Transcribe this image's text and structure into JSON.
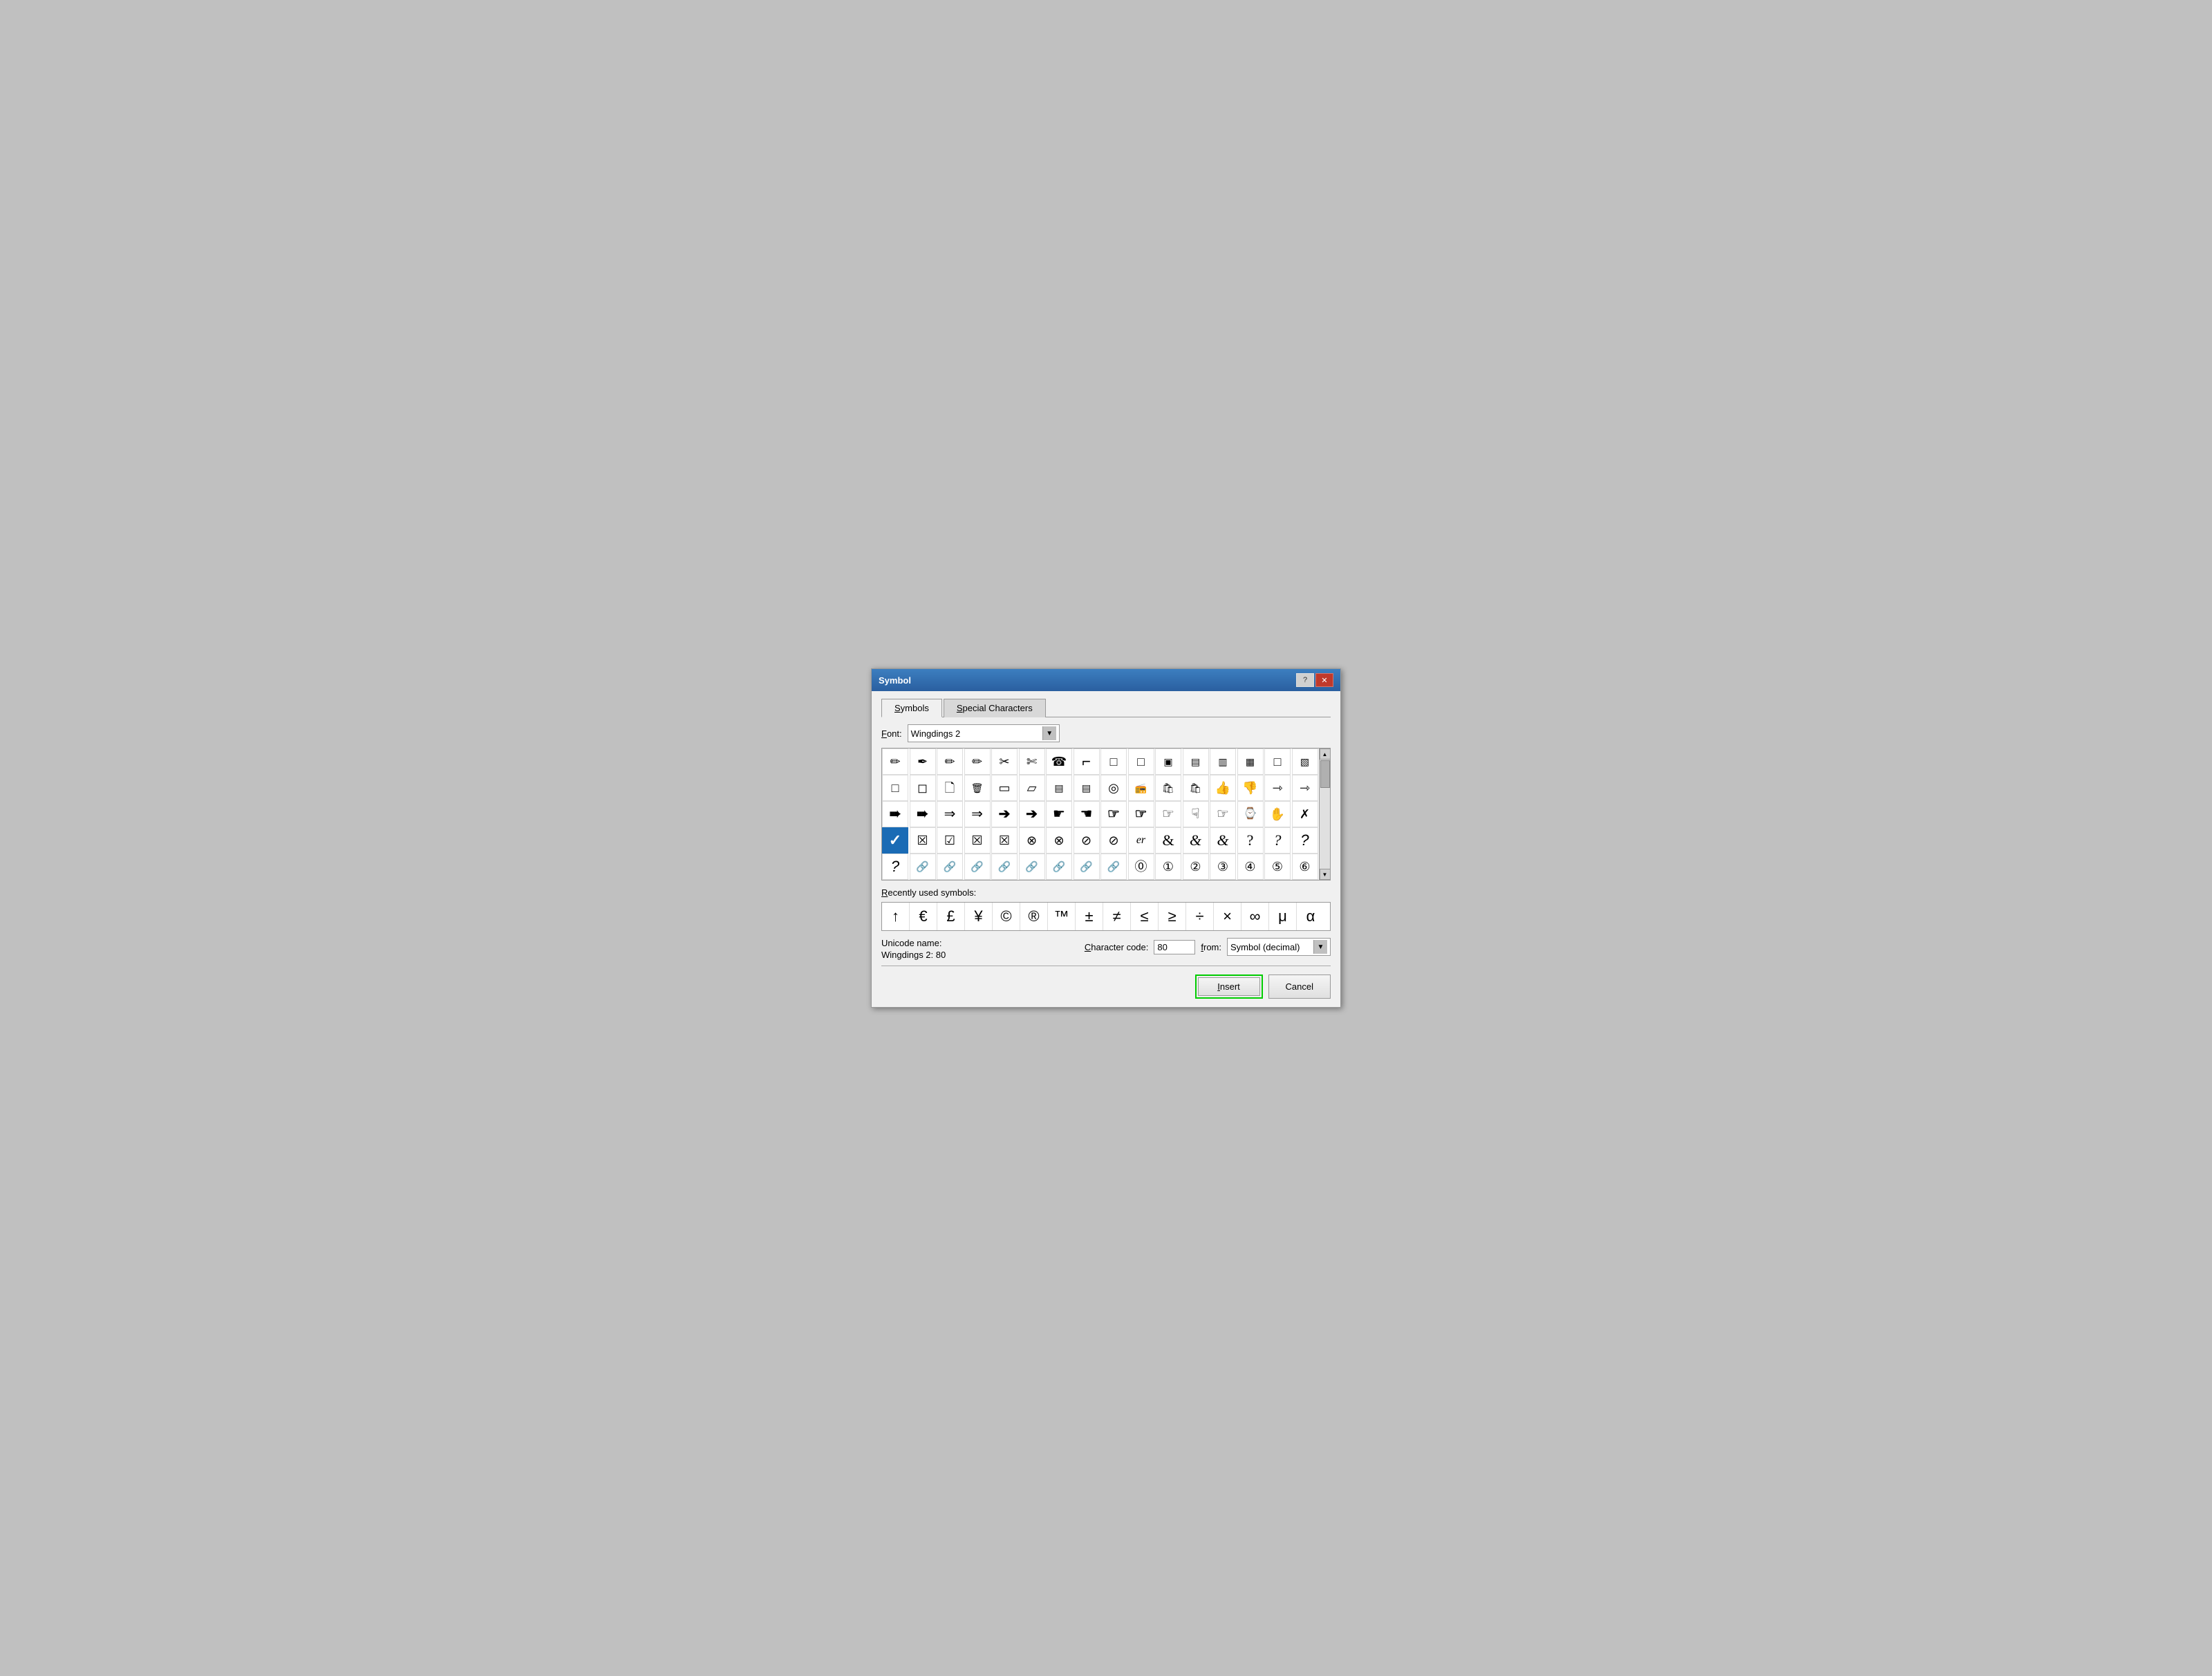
{
  "titleBar": {
    "title": "Symbol",
    "helpBtn": "?",
    "closeBtn": "✕"
  },
  "tabs": [
    {
      "id": "symbols",
      "label": "Symbols",
      "active": true
    },
    {
      "id": "special",
      "label": "Special Characters",
      "active": false
    }
  ],
  "font": {
    "label": "Font:",
    "value": "Wingdings 2"
  },
  "symbols": {
    "row1": [
      "✏",
      "✒",
      "✏",
      "✏",
      "✂",
      "✂",
      "☎",
      "⌐",
      "□",
      "□",
      "▣",
      "▣",
      "▤",
      "▤",
      "□"
    ],
    "row2": [
      "□",
      "□",
      "□",
      "🗑",
      "□",
      "□",
      "▤",
      "▤",
      "◎",
      "📻",
      "👜",
      "👜",
      "👍",
      "👎",
      "➾",
      "➾"
    ],
    "row3": [
      "➠",
      "➠",
      "➙",
      "➙",
      "➔",
      "➔",
      "☛",
      "☛",
      "☞",
      "☞",
      "☛",
      "☛",
      "☞",
      "⌚",
      "✋",
      "✗"
    ],
    "row4selected": [
      "✓",
      "☒",
      "☑",
      "☒",
      "☒",
      "⊗",
      "⊗",
      "⊘",
      "⊘",
      "er",
      "&",
      "&",
      "&",
      "?",
      "?",
      "?"
    ],
    "row5": [
      "?",
      "🔗",
      "🔗",
      "🔗",
      "🔗",
      "🔗",
      "🔗",
      "🔗",
      "🔗",
      "⓪",
      "①",
      "②",
      "③",
      "④",
      "⑤",
      "⑥"
    ],
    "selectedCell": 0,
    "selectedRow": 3
  },
  "recentlyUsed": {
    "label": "Recently used symbols:",
    "symbols": [
      "↑",
      "€",
      "£",
      "¥",
      "©",
      "®",
      "™",
      "±",
      "≠",
      "≤",
      "≥",
      "÷",
      "×",
      "∞",
      "μ",
      "α"
    ]
  },
  "unicodeInfo": {
    "nameLabel": "Unicode name:",
    "valueLabel": "Wingdings 2: 80"
  },
  "characterCode": {
    "label": "Character code:",
    "value": "80",
    "fromLabel": "from:",
    "fromValue": "Symbol (decimal)"
  },
  "buttons": {
    "insert": "Insert",
    "cancel": "Cancel"
  }
}
